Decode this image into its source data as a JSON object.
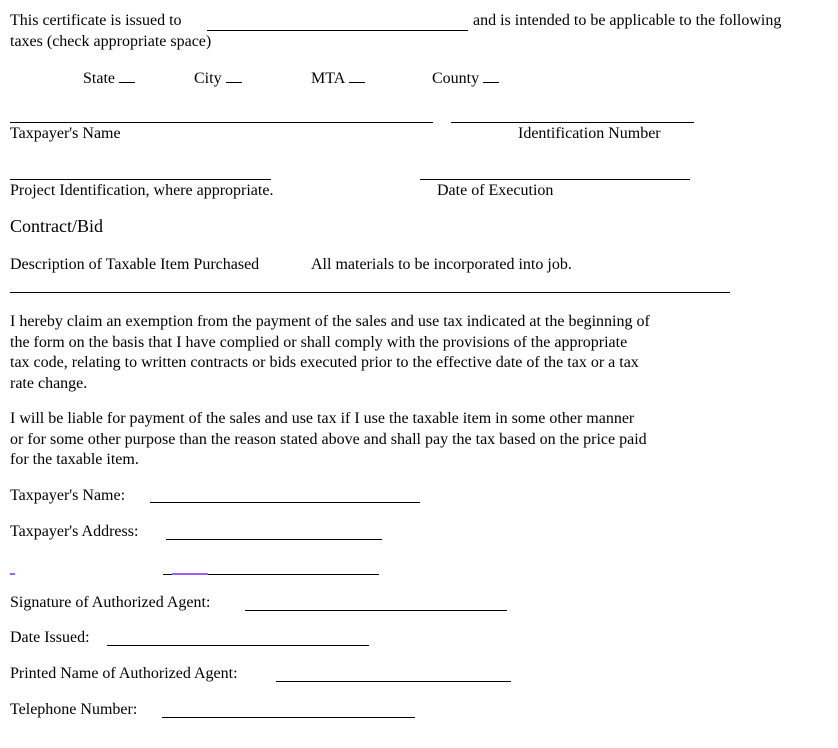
{
  "header": {
    "issued_to_prefix": "This certificate is issued to",
    "issued_to_value": "",
    "issued_to_suffix": "and is intended to be applicable to the following",
    "taxes_line": "taxes (check appropriate space)"
  },
  "tax_options": [
    {
      "label": "State",
      "checked": false
    },
    {
      "label": "City",
      "checked": false
    },
    {
      "label": "MTA",
      "checked": false
    },
    {
      "label": "County",
      "checked": false
    }
  ],
  "fields_top": {
    "taxpayer_name_label": "Taxpayer's Name",
    "taxpayer_name_value": "",
    "identification_number_label": "Identification Number",
    "identification_number_value": "",
    "project_identification_label": "Project Identification, where appropriate.",
    "project_identification_value": "",
    "date_of_execution_label": "Date of Execution",
    "date_of_execution_value": ""
  },
  "contract_bid": "Contract/Bid",
  "description": {
    "label": "Description of Taxable Item Purchased",
    "value": "All materials to be incorporated into job."
  },
  "paragraphs": {
    "exemption_claim": "I hereby claim an exemption from the payment of the sales and use tax indicated at the beginning of\nthe form on the basis that I have complied or shall comply with the provisions of the appropriate\ntax code, relating to written contracts or bids executed prior to the effective date of the tax or a tax\nrate change.",
    "liability": "I will be liable for payment of the sales and use tax if I use the taxable item in some other manner\nor for some other purpose than the reason stated above and shall pay the tax based on the price paid\nfor the taxable item."
  },
  "fields_bottom": {
    "taxpayer_name_label": "Taxpayer's Name:",
    "taxpayer_name_value": "",
    "taxpayer_address_label": "Taxpayer's Address:",
    "taxpayer_address_value": "",
    "taxpayer_address_line2_value": "",
    "signature_label": "Signature of Authorized Agent:",
    "signature_value": "",
    "date_issued_label": "Date Issued:",
    "date_issued_value": "",
    "printed_name_label": "Printed Name of Authorized Agent:",
    "printed_name_value": "",
    "telephone_label": "Telephone Number:",
    "telephone_value": ""
  },
  "colors": {
    "text": "#000000",
    "cursor_highlight": "#a65cf0"
  }
}
